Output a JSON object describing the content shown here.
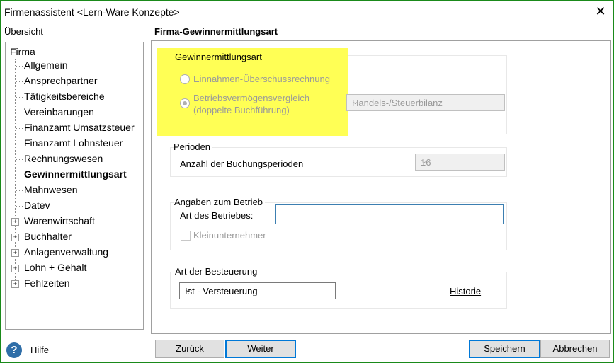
{
  "window": {
    "title": "Firmenassistent <Lern-Ware Konzepte>",
    "close_icon": "close-icon"
  },
  "overview": {
    "label": "Übersicht",
    "tree": {
      "root": "Firma",
      "items": [
        {
          "label": "Allgemein",
          "expandable": false,
          "selected": false
        },
        {
          "label": "Ansprechpartner",
          "expandable": false,
          "selected": false
        },
        {
          "label": "Tätigkeitsbereiche",
          "expandable": false,
          "selected": false
        },
        {
          "label": "Vereinbarungen",
          "expandable": false,
          "selected": false
        },
        {
          "label": "Finanzamt Umsatzsteuer",
          "expandable": false,
          "selected": false
        },
        {
          "label": "Finanzamt Lohnsteuer",
          "expandable": false,
          "selected": false
        },
        {
          "label": "Rechnungswesen",
          "expandable": false,
          "selected": false
        },
        {
          "label": "Gewinnermittlungsart",
          "expandable": false,
          "selected": true
        },
        {
          "label": "Mahnwesen",
          "expandable": false,
          "selected": false
        },
        {
          "label": "Datev",
          "expandable": false,
          "selected": false
        },
        {
          "label": "Warenwirtschaft",
          "expandable": true,
          "selected": false
        },
        {
          "label": "Buchhalter",
          "expandable": true,
          "selected": false
        },
        {
          "label": "Anlagenverwaltung",
          "expandable": true,
          "selected": false
        },
        {
          "label": "Lohn + Gehalt",
          "expandable": true,
          "selected": false
        },
        {
          "label": "Fehlzeiten",
          "expandable": true,
          "selected": false
        }
      ]
    }
  },
  "panel": {
    "title": "Firma-Gewinnermittlungsart",
    "gewinnermittlung": {
      "title": "Gewinnermittlungsart",
      "option1": "Einnahmen-Überschussrechnung",
      "option2_line1": "Betriebsvermögensvergleich",
      "option2_line2": "(doppelte Buchführung)",
      "bilanz_select": "Handels-/Steuerbilanz"
    },
    "perioden": {
      "title": "Perioden",
      "label": "Anzahl der Buchungsperioden",
      "value": "16"
    },
    "betrieb": {
      "title": "Angaben zum Betrieb",
      "art_label": "Art des Betriebes:",
      "art_value": "",
      "kleinunternehmer": "Kleinunternehmer"
    },
    "besteuerung": {
      "title": "Art der Besteuerung",
      "value": "Ist - Versteuerung",
      "historie": "Historie"
    }
  },
  "footer": {
    "help": "Hilfe",
    "back": "Zurück",
    "next": "Weiter",
    "save": "Speichern",
    "cancel": "Abbrechen"
  },
  "colors": {
    "highlight": "#ffff55",
    "frame": "#1a8a1a",
    "focus": "#0078d7"
  }
}
